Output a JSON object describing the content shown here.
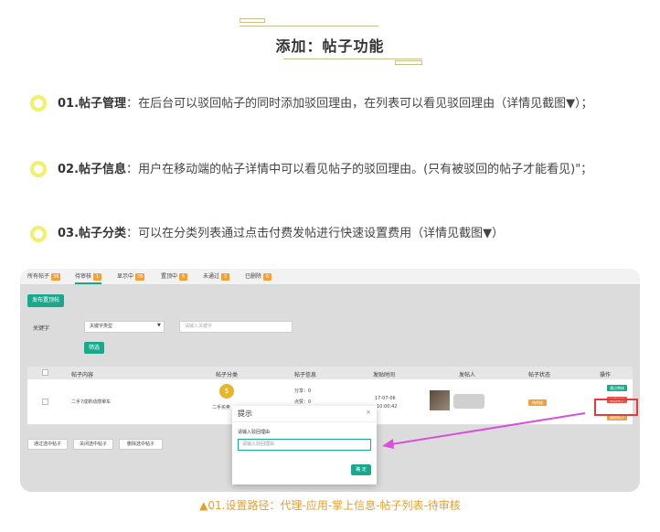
{
  "header": {
    "title": "添加：帖子功能"
  },
  "features": [
    {
      "num": "01.",
      "name": "帖子管理",
      "sep": "：",
      "text": "在后台可以驳回帖子的同时添加驳回理由，在列表可以看见驳回理由（详情见截图▼）；"
    },
    {
      "num": "02.",
      "name": "帖子信息",
      "sep": "：",
      "text": "用户在移动端的帖子详情中可以看见帖子的驳回理由。(只有被驳回的帖子才能看见)\"；"
    },
    {
      "num": "03.",
      "name": "帖子分类",
      "sep": "：",
      "text": "可以在分类列表通过点击付费发帖进行快速设置费用（详情见截图▼）"
    }
  ],
  "screenshot": {
    "tabs": [
      {
        "label": "所有帖子",
        "count": "36"
      },
      {
        "label": "待审核",
        "count": "1"
      },
      {
        "label": "显示中",
        "count": "26"
      },
      {
        "label": "置顶中",
        "count": "6"
      },
      {
        "label": "未通过",
        "count": "3"
      },
      {
        "label": "已删除",
        "count": "6"
      }
    ],
    "publish_button": "发布置顶帖",
    "filter": {
      "keyword_label": "关键字",
      "type_select": "关键字类型",
      "keyword_placeholder": "请输入关键字",
      "submit": "筛选"
    },
    "columns": [
      "帖子内容",
      "帖子分类",
      "帖子信息",
      "发贴时间",
      "发帖人",
      "帖子状态",
      "操作"
    ],
    "row": {
      "content": "二手7成新动感單车",
      "category": "二手买卖",
      "info_share": "分享：0",
      "info_click": "点赞：0",
      "date": "17-07-06",
      "time": "10:00:42",
      "status": "待审核",
      "action_pass": "通过审核",
      "action_reject": "驳回帖子",
      "action_delete": "删除帖子"
    },
    "bulk": [
      "通过选中帖子",
      "关闭选中帖子",
      "删除选中帖子"
    ],
    "dialog": {
      "title": "提示",
      "close": "×",
      "label": "请输入驳回理由",
      "placeholder": "请输入驳回理由",
      "ok": "确 定"
    }
  },
  "caption": "▲01.设置路径：代理-应用-掌上信息-帖子列表-待审核",
  "colors": {
    "accent_green": "#1aa88c",
    "badge_orange": "#f0a23a",
    "caption": "#e6a02b",
    "highlight_red": "#e23b3b",
    "arrow": "#d94fd9"
  }
}
